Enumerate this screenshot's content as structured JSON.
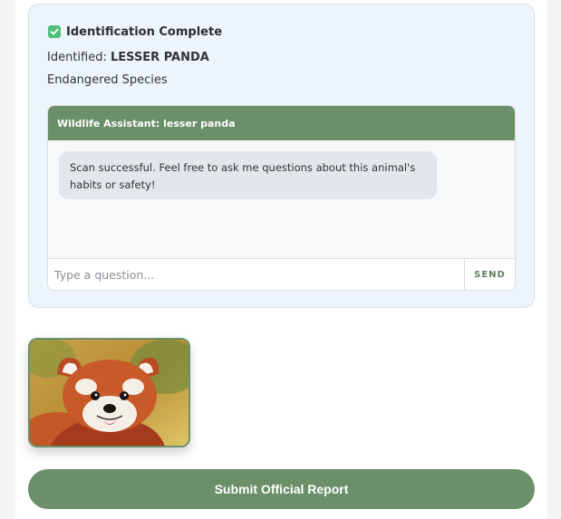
{
  "result": {
    "status_title": "Identification Complete",
    "identified_label": "Identified:",
    "species": "LESSER PANDA",
    "status_sub": "Endangered Species"
  },
  "chat": {
    "header": "Wildlife Assistant: lesser panda",
    "messages": [
      {
        "text": "Scan successful. Feel free to ask me questions about this animal's habits or safety!"
      }
    ],
    "input_placeholder": "Type a question...",
    "send_label": "SEND"
  },
  "photo": {
    "subject": "red panda photo"
  },
  "actions": {
    "submit_label": "Submit Official Report"
  },
  "colors": {
    "accent": "#6b8f69",
    "check": "#4fbf7a",
    "card_bg": "#eef4fc"
  },
  "icons": {
    "status": "check-icon"
  }
}
